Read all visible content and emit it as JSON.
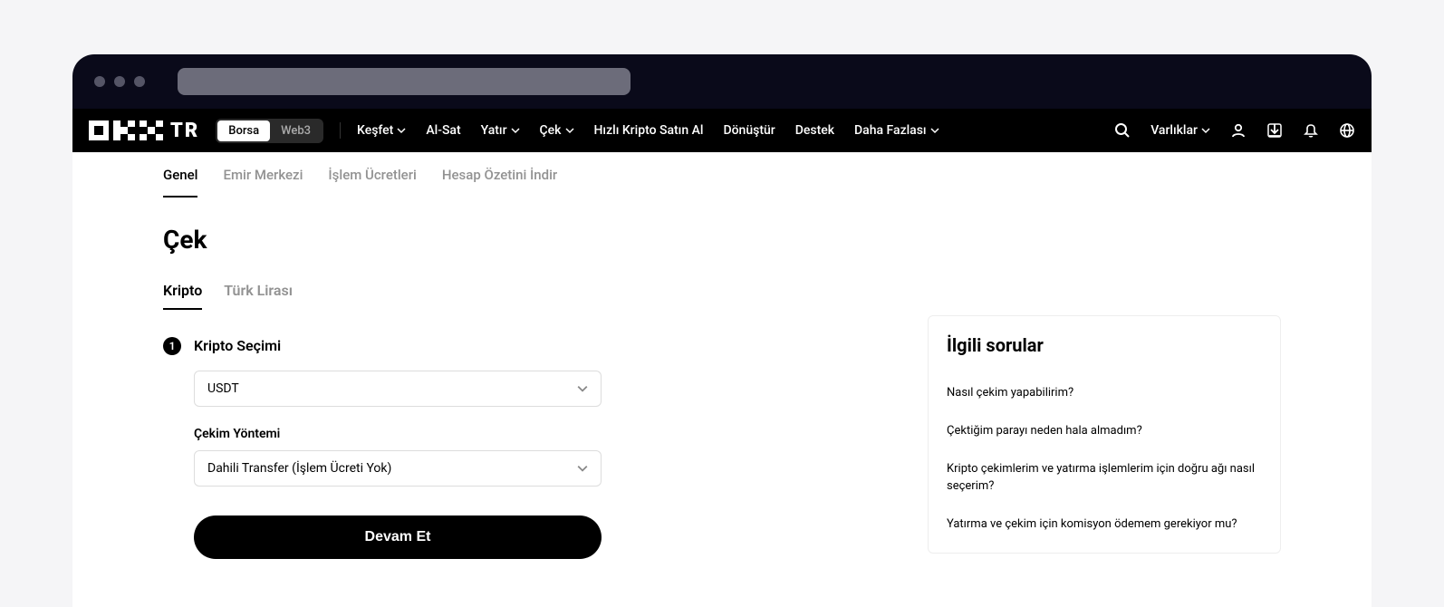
{
  "logo_text": "TR",
  "mode_switch": {
    "option1": "Borsa",
    "option2": "Web3"
  },
  "nav": {
    "items": [
      "Keşfet",
      "Al-Sat",
      "Yatır",
      "Çek",
      "Hızlı Kripto Satın Al",
      "Dönüştür",
      "Destek",
      "Daha Fazlası"
    ],
    "assets_label": "Varlıklar"
  },
  "sub_tabs": [
    "Genel",
    "Emir Merkezi",
    "İşlem Ücretleri",
    "Hesap Özetini İndir"
  ],
  "page_title": "Çek",
  "type_tabs": [
    "Kripto",
    "Türk Lirası"
  ],
  "step1": {
    "number": "1",
    "title": "Kripto Seçimi",
    "crypto_value": "USDT",
    "method_label": "Çekim Yöntemi",
    "method_value": "Dahili Transfer (İşlem Ücreti Yok)",
    "continue_label": "Devam Et"
  },
  "faq": {
    "title": "İlgili sorular",
    "items": [
      "Nasıl çekim yapabilirim?",
      "Çektiğim parayı neden hala almadım?",
      "Kripto çekimlerim ve yatırma işlemlerim için doğru ağı nasıl seçerim?",
      "Yatırma ve çekim için komisyon ödemem gerekiyor mu?"
    ]
  }
}
